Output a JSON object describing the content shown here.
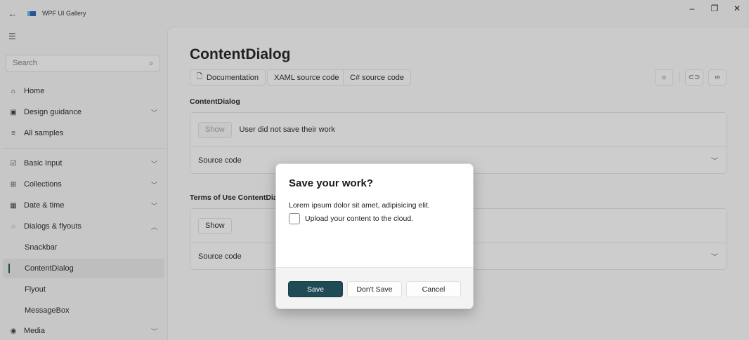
{
  "window": {
    "title": "WPF UI Gallery",
    "back_icon": "arrow-left-icon",
    "controls": [
      "minimize-icon",
      "restore-icon",
      "close-icon"
    ]
  },
  "sidebar": {
    "search_placeholder": "Search",
    "items": [
      {
        "label": "Home",
        "icon": "home-icon"
      },
      {
        "label": "Design guidance",
        "icon": "design-icon",
        "expandable": true
      },
      {
        "label": "All samples",
        "icon": "list-icon"
      },
      {
        "label": "Basic Input",
        "icon": "checkbox-icon",
        "expandable": true
      },
      {
        "label": "Collections",
        "icon": "grid-icon",
        "expandable": true
      },
      {
        "label": "Date & time",
        "icon": "calendar-clock-icon",
        "expandable": true
      },
      {
        "label": "Dialogs & flyouts",
        "icon": "chat-icon",
        "expanded": true
      },
      {
        "label": "Snackbar"
      },
      {
        "label": "ContentDialog",
        "selected": true
      },
      {
        "label": "Flyout"
      },
      {
        "label": "MessageBox"
      },
      {
        "label": "Media",
        "icon": "play-circle-icon",
        "expandable": true
      }
    ]
  },
  "main": {
    "title": "ContentDialog",
    "links": [
      "Documentation",
      "XAML source code",
      "C# source code"
    ],
    "toolbar_icons": [
      "theme-icon",
      "link-icon",
      "share-icon"
    ],
    "sections": [
      {
        "label": "ContentDialog",
        "button": "Show",
        "button_disabled": true,
        "status": "User did not save their work",
        "source_label": "Source code"
      },
      {
        "label": "Terms of Use ContentDialog",
        "button": "Show",
        "button_disabled": false,
        "status": "",
        "source_label": "Source code"
      }
    ]
  },
  "dialog": {
    "title": "Save your work?",
    "text": "Lorem ipsum dolor sit amet, adipisicing elit.",
    "checkbox_label": "Upload your content to the cloud.",
    "checkbox_checked": false,
    "primary_button": "Save",
    "secondary_button": "Don't Save",
    "close_button": "Cancel",
    "accent_color": "#1e4b55"
  }
}
